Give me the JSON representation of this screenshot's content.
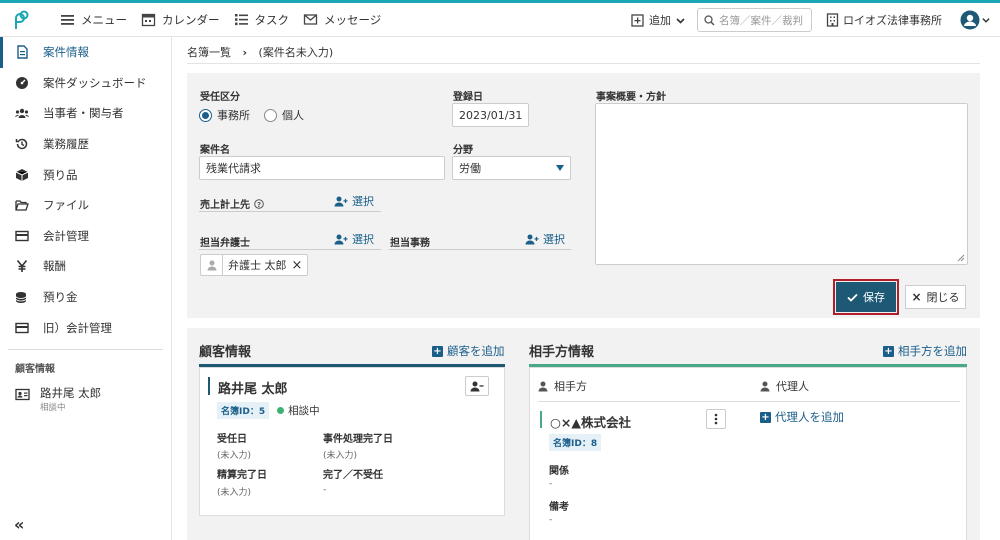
{
  "topbar": {
    "menu": "メニュー",
    "calendar": "カレンダー",
    "task": "タスク",
    "message": "メッセージ",
    "add": "追加",
    "search_placeholder": "名簿／案件／裁判",
    "firm": "ロイオズ法律事務所"
  },
  "sidebar": {
    "items": [
      {
        "label": "案件情報"
      },
      {
        "label": "案件ダッシュボード"
      },
      {
        "label": "当事者・関与者"
      },
      {
        "label": "業務履歴"
      },
      {
        "label": "預り品"
      },
      {
        "label": "ファイル"
      },
      {
        "label": "会計管理"
      },
      {
        "label": "報酬"
      },
      {
        "label": "預り金"
      },
      {
        "label": "旧）会計管理"
      }
    ],
    "client_heading": "顧客情報",
    "client_name": "路井尾 太郎",
    "client_status": "相談中",
    "collapse": "«"
  },
  "breadcrumb": {
    "root": "名簿一覧",
    "sep": "›",
    "current": "(案件名未入力)"
  },
  "form": {
    "intake_label": "受任区分",
    "intake_opt1": "事務所",
    "intake_opt2": "個人",
    "reg_label": "登録日",
    "reg_value": "2023/01/31",
    "summary_label": "事案概要・方針",
    "case_label": "案件名",
    "case_value": "残業代請求",
    "field_label": "分野",
    "field_value": "労働",
    "sales_label": "売上計上先",
    "select": "選択",
    "lawyer_label": "担当弁護士",
    "staff_label": "担当事務",
    "lawyer_chip": "弁護士 太郎",
    "save": "保存",
    "close": "閉じる"
  },
  "customer": {
    "title": "顧客情報",
    "add": "顧客を追加",
    "name": "路井尾 太郎",
    "id_badge": "名簿ID：5",
    "status": "相談中",
    "accept_date_label": "受任日",
    "accept_date_value": "(未入力)",
    "done_date_label": "事件処理完了日",
    "done_date_value": "(未入力)",
    "settle_label": "精算完了日",
    "settle_value": "(未入力)",
    "complete_label": "完了／不受任",
    "complete_value": "-"
  },
  "opponent": {
    "title": "相手方情報",
    "add": "相手方を追加",
    "col1": "相手方",
    "col2": "代理人",
    "company": "○×▲株式会社",
    "id_badge": "名簿ID：8",
    "agent_add": "代理人を追加",
    "relation_label": "関係",
    "relation_value": "-",
    "note_label": "備考",
    "note_value": "-"
  },
  "colors": {
    "accent": "#1a5f8a",
    "top_line": "#1aa6b4",
    "save_bg": "#1d5875",
    "highlight": "#b01f2a",
    "status_dot": "#3cb371"
  }
}
